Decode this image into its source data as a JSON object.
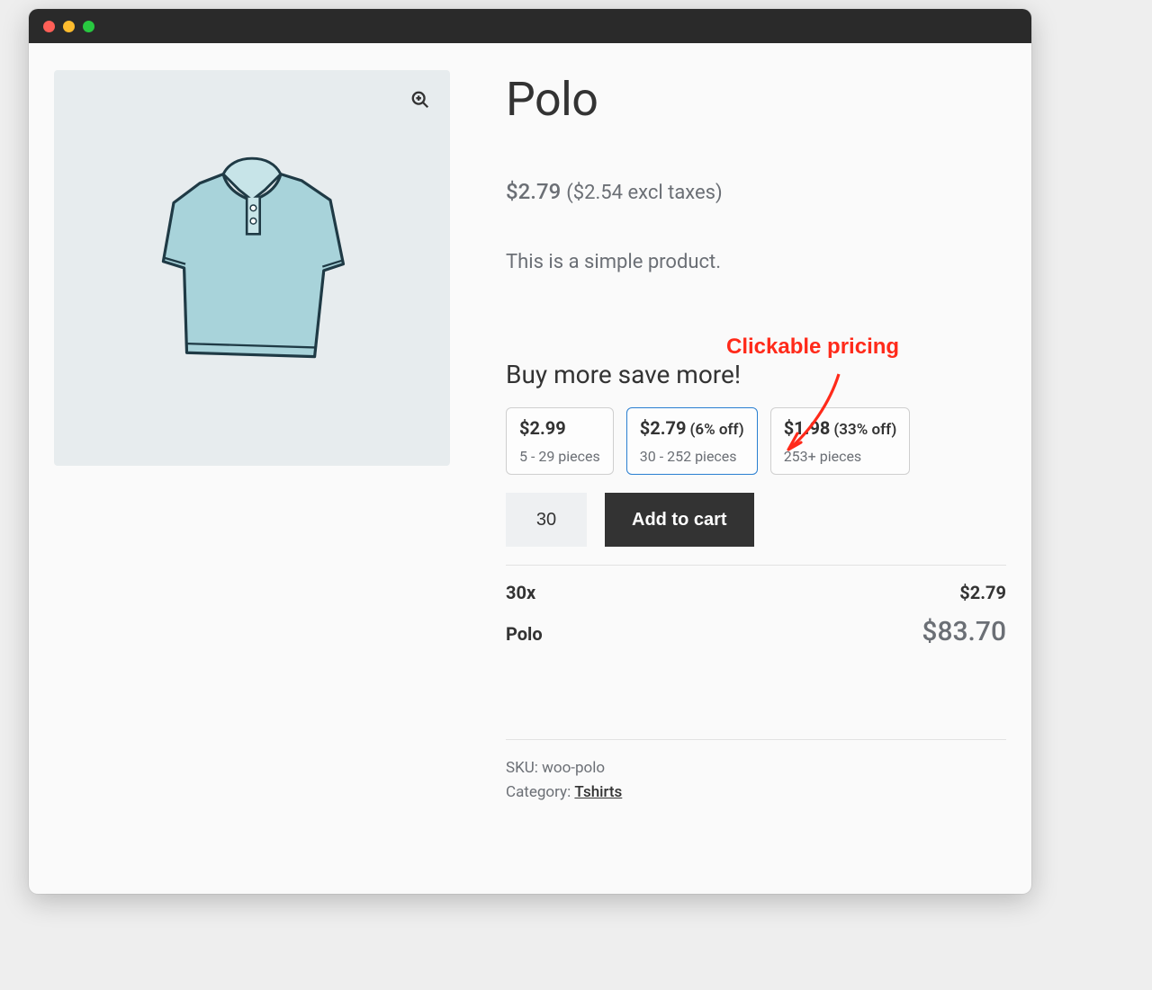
{
  "product": {
    "title": "Polo",
    "price": "$2.79",
    "price_excl": "($2.54 excl taxes)",
    "description": "This is a simple product.",
    "tiers_heading": "Buy more save more!",
    "tiers": [
      {
        "price": "$2.99",
        "discount": "",
        "qty": "5 - 29 pieces",
        "selected": false
      },
      {
        "price": "$2.79",
        "discount": "(6% off)",
        "qty": "30 - 252 pieces",
        "selected": true
      },
      {
        "price": "$1.98",
        "discount": "(33% off)",
        "qty": "253+ pieces",
        "selected": false
      }
    ],
    "quantity_value": "30",
    "add_to_cart_label": "Add to cart",
    "summary": {
      "qty_label": "30x",
      "unit_price": "$2.79",
      "name": "Polo",
      "total": "$83.70"
    },
    "sku_label": "SKU: ",
    "sku": "woo-polo",
    "category_label": "Category: ",
    "category": "Tshirts"
  },
  "annotation": {
    "text": "Clickable pricing"
  }
}
